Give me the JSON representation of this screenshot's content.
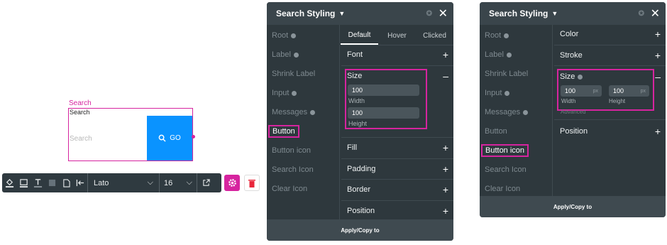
{
  "canvas": {
    "widget_label": "Search",
    "widget_title": "Search",
    "input_placeholder": "Search",
    "go_label": "GO"
  },
  "toolbar": {
    "font": "Lato",
    "font_size": "16"
  },
  "panel1": {
    "title": "Search Styling",
    "sidebar": [
      "Root",
      "Label",
      "Shrink Label",
      "Input",
      "Messages",
      "Button",
      "Button icon",
      "Search Icon",
      "Clear Icon"
    ],
    "selected": "Button",
    "tabs": [
      "Default",
      "Hover",
      "Clicked"
    ],
    "sections": {
      "font": "Font",
      "size": "Size",
      "fill": "Fill",
      "padding": "Padding",
      "border": "Border",
      "position": "Position"
    },
    "width_value": "100",
    "width_label": "Width",
    "height_value": "100",
    "height_label": "Height",
    "footer": "Apply/Copy to"
  },
  "panel2": {
    "title": "Search Styling",
    "sidebar": [
      "Root",
      "Label",
      "Shrink Label",
      "Input",
      "Messages",
      "Button",
      "Button icon",
      "Search Icon",
      "Clear Icon"
    ],
    "selected": "Button icon",
    "sections": {
      "color": "Color",
      "stroke": "Stroke",
      "size": "Size",
      "advanced": "Advanced",
      "position": "Position"
    },
    "width_value": "100",
    "width_unit": "px",
    "width_label": "Width",
    "height_value": "100",
    "height_unit": "px",
    "height_label": "Height",
    "footer": "Apply/Copy to"
  },
  "colors": {
    "accent": "#d6249f",
    "button": "#0a93ff",
    "panel": "#2e383d"
  }
}
